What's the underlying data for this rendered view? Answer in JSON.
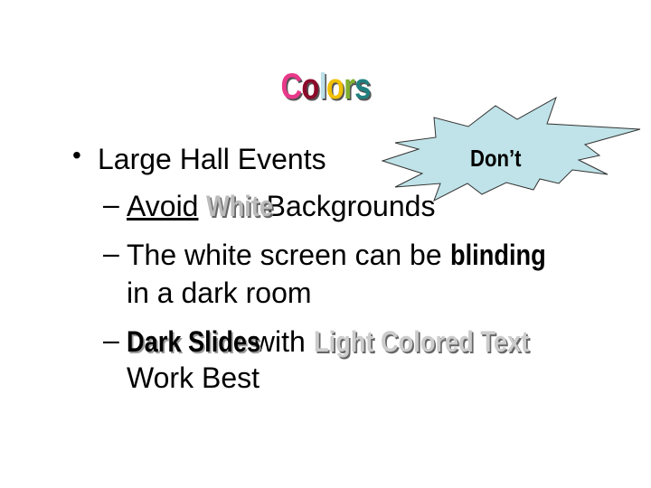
{
  "title": {
    "letters": [
      "C",
      "o",
      "l",
      "o",
      "r",
      "s"
    ],
    "colors": [
      "#e8388a",
      "#8b0a2a",
      "#bde0e8",
      "#f0c000",
      "#80b030",
      "#208080"
    ]
  },
  "bullet": {
    "marker": "•",
    "text": "Large Hall Events"
  },
  "callout": {
    "text": "Don’t",
    "fill": "#bfe3e8"
  },
  "subs": {
    "dash": "–",
    "s1": {
      "a": "Avoid",
      "b": "White",
      "c": " Backgrounds"
    },
    "s2": {
      "a": "The white screen can be ",
      "b": "blinding",
      "c": "in a dark room"
    },
    "s3": {
      "a": "Dark Slides",
      "b": " with ",
      "c": "Light Colored Text",
      "d": "Work Best"
    }
  }
}
